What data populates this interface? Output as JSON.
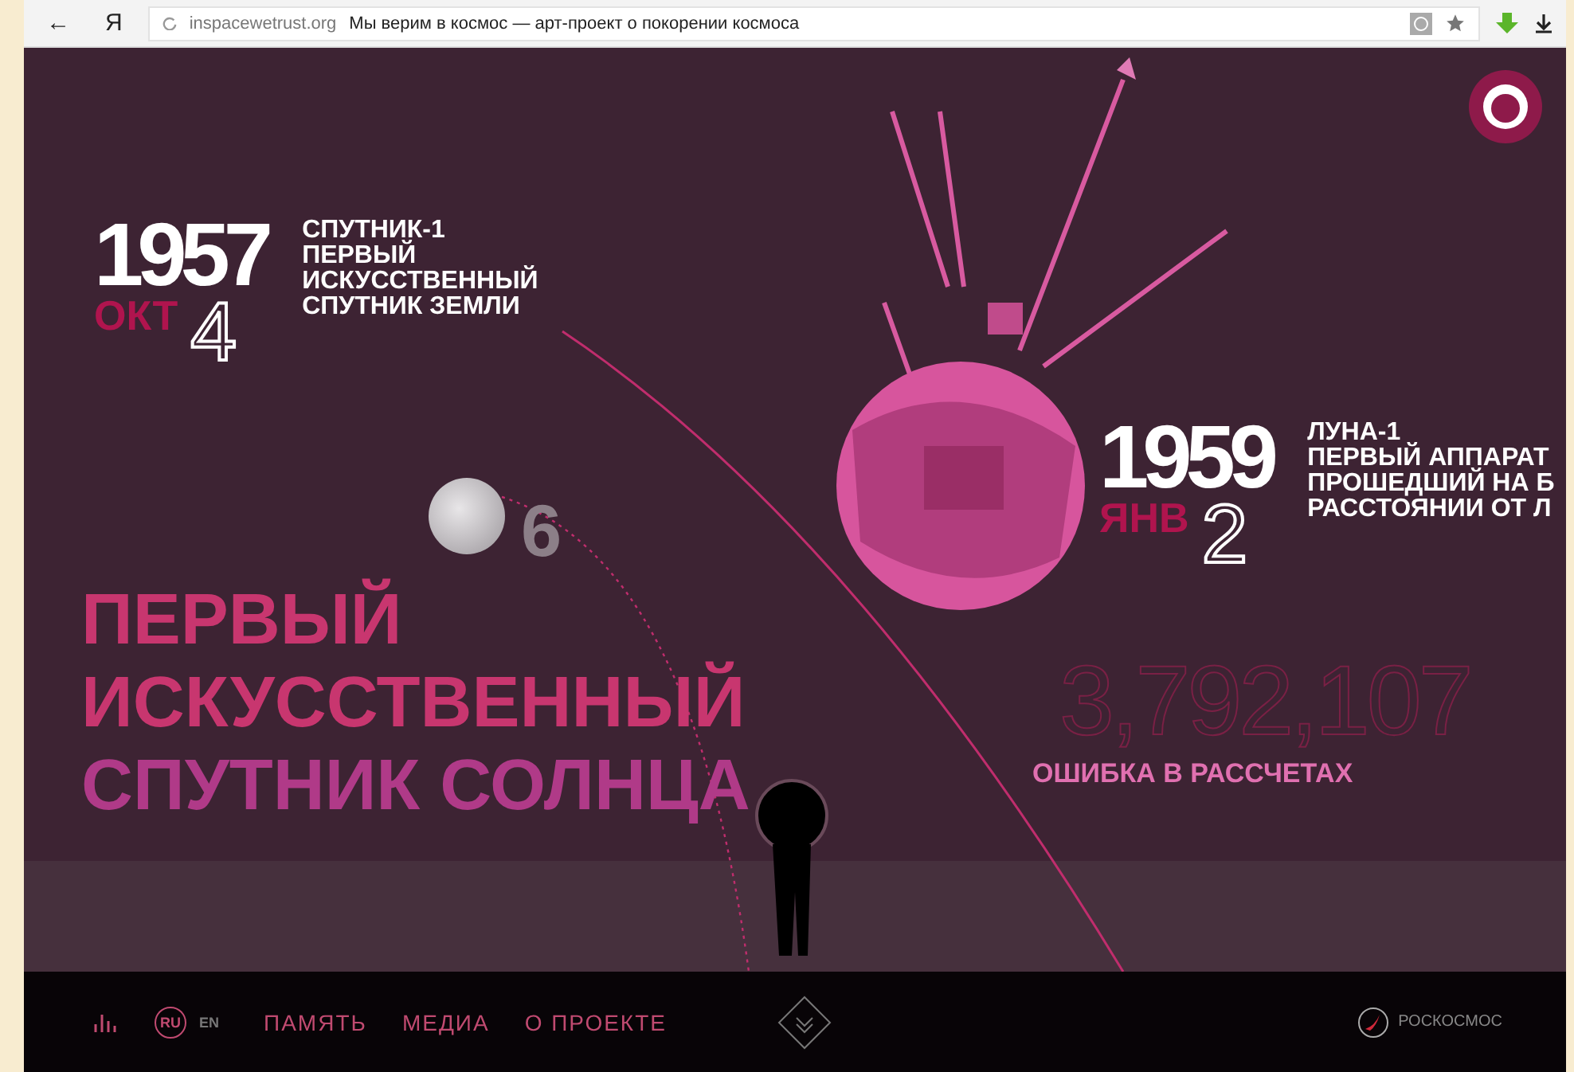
{
  "browser": {
    "back": "←",
    "yandex": "Я",
    "url": "inspacewetrust.org",
    "page_title": "Мы верим в космос — арт-проект о покорении космоса"
  },
  "events": [
    {
      "year": "1957",
      "month": "ОКТ",
      "day": "4",
      "lines": [
        "СПУТНИК-1",
        "ПЕРВЫЙ",
        "ИСКУССТВЕННЫЙ",
        "СПУТНИК ЗЕМЛИ"
      ]
    },
    {
      "year": "1959",
      "month": "ЯНВ",
      "day": "2",
      "lines": [
        "ЛУНА-1",
        "ПЕРВЫЙ АППАРАТ",
        "ПРОШЕДШИЙ НА Б",
        "РАССТОЯНИИ ОТ Л"
      ]
    }
  ],
  "moon_count": "6",
  "headline": [
    "ПЕРВЫЙ",
    "ИСКУССТВЕННЫЙ",
    "СПУТНИК СОЛНЦА"
  ],
  "faint_number": "3,792,107",
  "error_label": "ОШИБКА В РАССЧЕТАХ",
  "footer": {
    "languages": [
      {
        "label": "RU",
        "selected": true
      },
      {
        "label": "EN",
        "selected": false
      }
    ],
    "nav": [
      "ПАМЯТЬ",
      "МЕДИА",
      "О ПРОЕКТЕ"
    ],
    "partner": "РОСКОСМОС"
  }
}
